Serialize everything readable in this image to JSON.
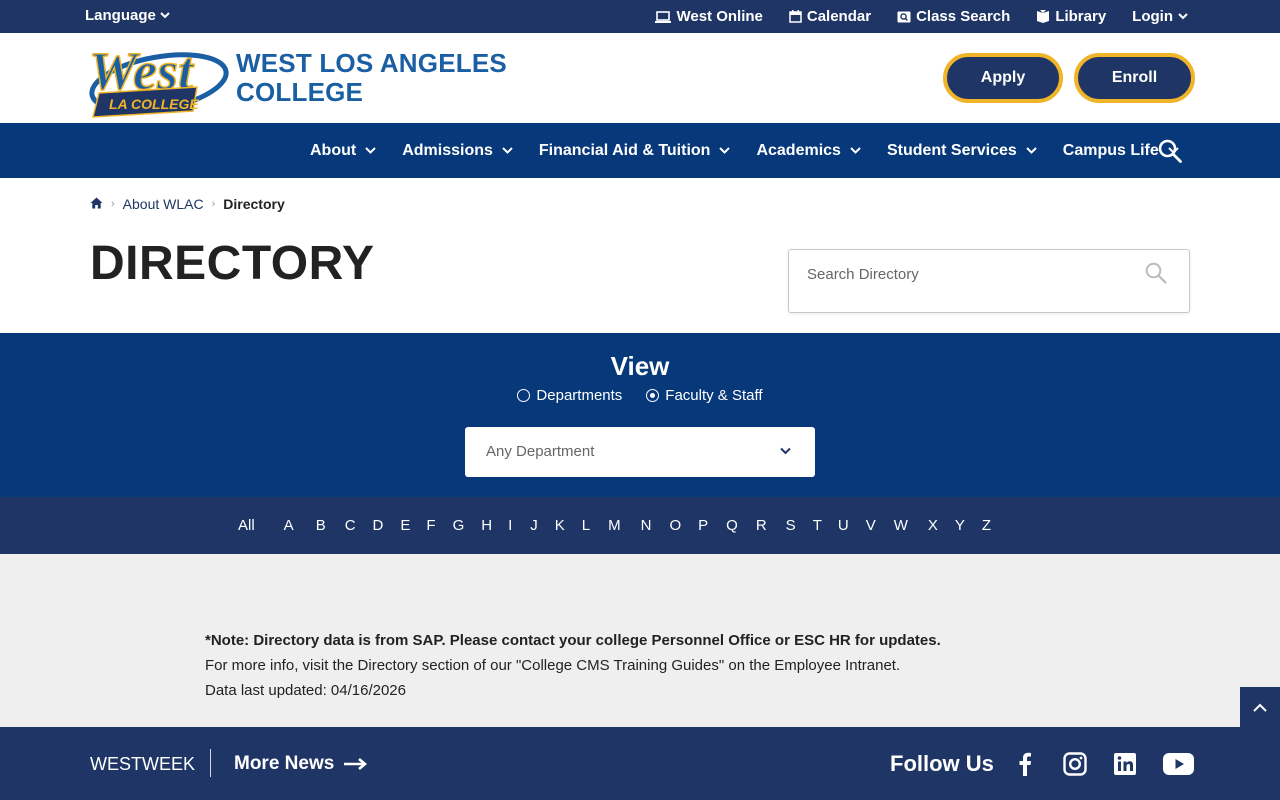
{
  "utility": {
    "language": "Language",
    "links": [
      {
        "label": "West Online",
        "icon": "laptop-icon"
      },
      {
        "label": "Calendar",
        "icon": "calendar-icon"
      },
      {
        "label": "Class Search",
        "icon": "class-search-icon"
      },
      {
        "label": "Library",
        "icon": "book-icon"
      }
    ],
    "login": "Login"
  },
  "header": {
    "logo_text": "West",
    "logo_subtext": "LA COLLEGE",
    "college_name_line1": "WEST LOS ANGELES",
    "college_name_line2": "COLLEGE",
    "apply": "Apply",
    "enroll": "Enroll"
  },
  "nav": {
    "items": [
      "About",
      "Admissions",
      "Financial Aid & Tuition",
      "Academics",
      "Student Services",
      "Campus Life"
    ]
  },
  "breadcrumb": {
    "home_icon": "home-icon",
    "parent": "About WLAC",
    "current": "Directory"
  },
  "page": {
    "title": "DIRECTORY",
    "search_placeholder": "Search Directory"
  },
  "view": {
    "title": "View",
    "options": [
      "Departments",
      "Faculty & Staff"
    ],
    "selected": "Faculty & Staff",
    "department_select": "Any Department"
  },
  "alphabet": {
    "all": "All",
    "letters": [
      "A",
      "B",
      "C",
      "D",
      "E",
      "F",
      "G",
      "H",
      "I",
      "J",
      "K",
      "L",
      "M",
      "N",
      "O",
      "P",
      "Q",
      "R",
      "S",
      "T",
      "U",
      "V",
      "W",
      "X",
      "Y",
      "Z"
    ]
  },
  "note": {
    "line1": "*Note: Directory data is from SAP. Please contact your college Personnel Office or ESC HR for updates.",
    "line2": "For more info, visit the Directory section of our \"College CMS Training Guides\" on the Employee Intranet.",
    "line3": "Data last updated: 04/16/2026"
  },
  "footer": {
    "westweek": "WESTWEEK",
    "more_news": "More News",
    "follow_us": "Follow Us",
    "social": [
      "facebook-icon",
      "instagram-icon",
      "linkedin-icon",
      "youtube-icon"
    ]
  },
  "colors": {
    "navy": "#1e3565",
    "royal": "#07387a",
    "gold": "#f0b429",
    "brand_blue": "#1a5fa3",
    "light_gray": "#efefef"
  }
}
